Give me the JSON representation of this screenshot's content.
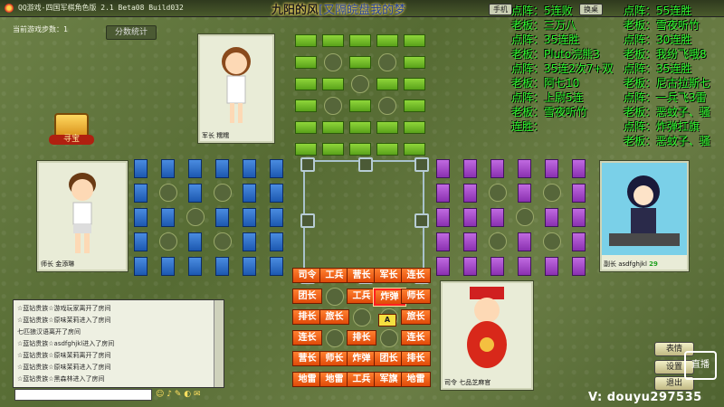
{
  "window": {
    "title": "QQ游戏-四国军棋角色版 2.1 Beta08 Build032",
    "banner_prefix": "九阳的风",
    "banner_highlight": "[又隔皖盘我的梦",
    "buttons": [
      "手机",
      "换桌"
    ]
  },
  "game": {
    "steps_label": "当前游戏步数：1",
    "stats_button": "分数统计",
    "treasure_label": "寻宝",
    "players": {
      "top": {
        "rank": "军长",
        "name": "糯糯"
      },
      "left": {
        "rank": "师长",
        "name": "金添琳"
      },
      "right": {
        "rank": "副长",
        "name": "asdfghjkl",
        "score": "29"
      },
      "bottom": {
        "rank": "司令",
        "name": "七品芝麻官"
      }
    },
    "pieces_rows": [
      [
        "司令",
        "工兵",
        "营长",
        "军长",
        "连长"
      ],
      [
        "团长",
        "",
        "工兵",
        "炸弹",
        "师长"
      ],
      [
        "排长",
        "旅长",
        "",
        "",
        "旅长"
      ],
      [
        "连长",
        "",
        "排长",
        "",
        "连长"
      ],
      [
        "营长",
        "师长",
        "炸弹",
        "团长",
        "排长"
      ],
      [
        "地雷",
        "地雷",
        "工兵",
        "军旗",
        "地雷"
      ]
    ],
    "marker": "A",
    "colors": {
      "green": "#6abb22",
      "blue": "#2a6cc8",
      "purple": "#a045c8",
      "orange": "#f06018"
    }
  },
  "scoreboard": {
    "left_col": [
      "点阵：5连败",
      "老板：三万八",
      "点阵：35连胜",
      "老板：Pluto浣熊3",
      "点阵：35连2次7+双",
      "老板：阿七10",
      "点阵：上尉5连",
      "老板：雪夜听竹",
      "连胜："
    ],
    "right_col": [
      "点阵：55连胜",
      "老板：雪夜听竹",
      "点阵：30连胜",
      "老板：我纷飞哦8",
      "点阵：35连胜",
      "老板：尼古拉斯七",
      "点阵：一兵飞3雷",
      "老板：恶蚊子、骚",
      "点阵：炸弹扛旗",
      "老板：恶蚊子、骚"
    ]
  },
  "chat": {
    "lines": [
      "☆蓝钻贵族☆游戏玩家离开了房间",
      "☆蓝钻贵族☆原味茉莉进入了房间",
      "七匹狼汉语离开了房间",
      "☆蓝钻贵族☆asdfghjkl进入了房间",
      "☆蓝钻贵族☆原味茉莉离开了房间",
      "☆蓝钻贵族☆原味茉莉进入了房间",
      "☆蓝钻贵族☆黑森林进入了房间"
    ]
  },
  "controls": {
    "emote": "表情",
    "settings": "设置",
    "quit": "退出"
  },
  "watermark": "V: douyu297535",
  "live_logo": "直播"
}
